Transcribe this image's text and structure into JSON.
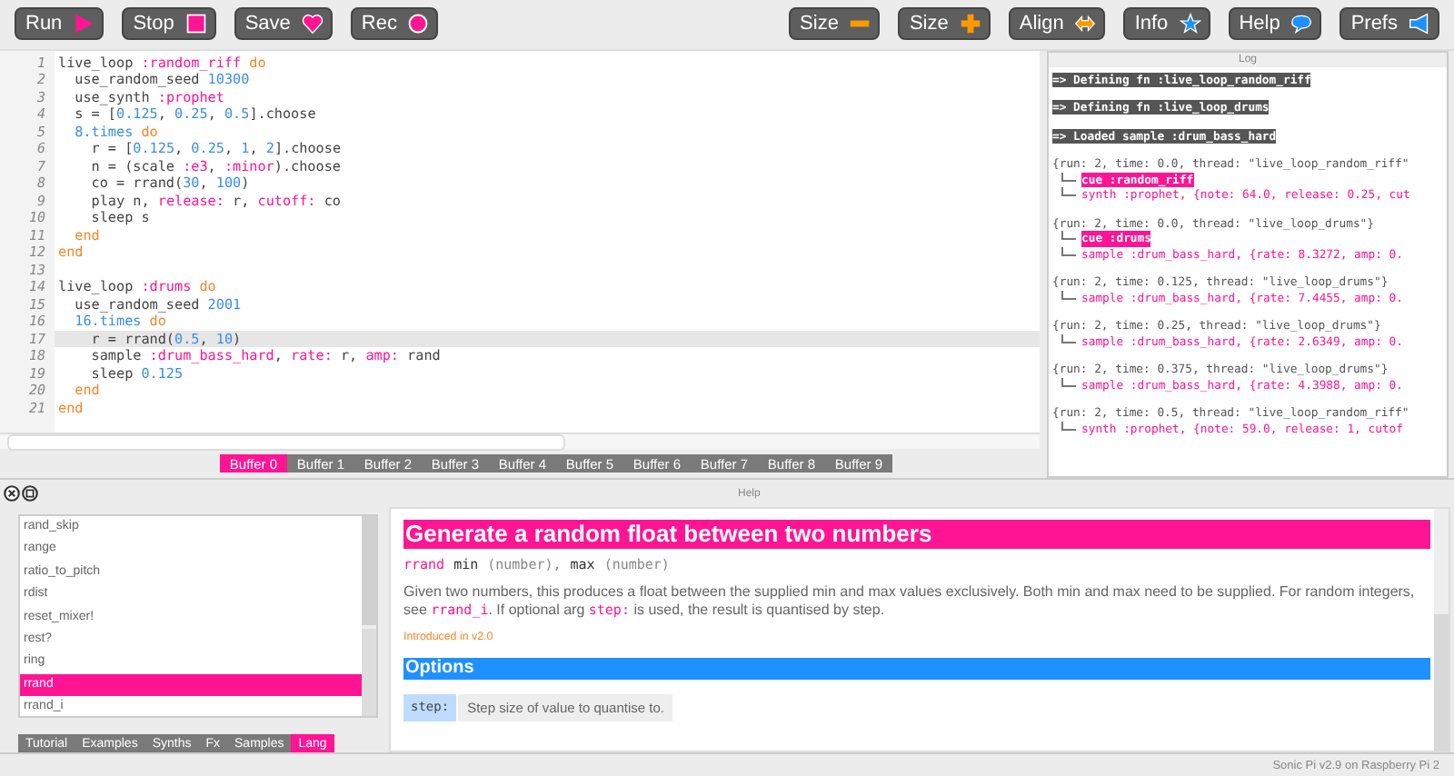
{
  "toolbar": {
    "left": [
      {
        "label": "Run",
        "kind": "play"
      },
      {
        "label": "Stop",
        "kind": "stop"
      },
      {
        "label": "Save",
        "kind": "heart"
      },
      {
        "label": "Rec",
        "kind": "record"
      }
    ],
    "right": [
      {
        "label": "Size",
        "kind": "minus"
      },
      {
        "label": "Size",
        "kind": "plus"
      },
      {
        "label": "Align",
        "kind": "align"
      },
      {
        "label": "Info",
        "kind": "star"
      },
      {
        "label": "Help",
        "kind": "bubble"
      },
      {
        "label": "Prefs",
        "kind": "speaker"
      }
    ]
  },
  "editor": {
    "lines": [
      {
        "number": "1",
        "current": false,
        "tokens": [
          {
            "kind": "plain",
            "text": "live_loop "
          },
          {
            "kind": "sym",
            "text": ":random_riff"
          },
          {
            "kind": "kw",
            "text": " do"
          }
        ]
      },
      {
        "number": "2",
        "current": false,
        "tokens": [
          {
            "kind": "plain",
            "text": "  use_random_seed "
          },
          {
            "kind": "num",
            "text": "10300"
          }
        ]
      },
      {
        "number": "3",
        "current": false,
        "tokens": [
          {
            "kind": "plain",
            "text": "  use_synth "
          },
          {
            "kind": "sym",
            "text": ":prophet"
          }
        ]
      },
      {
        "number": "4",
        "current": false,
        "tokens": [
          {
            "kind": "plain",
            "text": "  s = ["
          },
          {
            "kind": "num",
            "text": "0.125"
          },
          {
            "kind": "plain",
            "text": ", "
          },
          {
            "kind": "num",
            "text": "0.25"
          },
          {
            "kind": "plain",
            "text": ", "
          },
          {
            "kind": "num",
            "text": "0.5"
          },
          {
            "kind": "plain",
            "text": "].choose"
          }
        ]
      },
      {
        "number": "5",
        "current": false,
        "tokens": [
          {
            "kind": "num",
            "text": "  8.times"
          },
          {
            "kind": "kw",
            "text": " do"
          }
        ]
      },
      {
        "number": "6",
        "current": false,
        "tokens": [
          {
            "kind": "plain",
            "text": "    r = ["
          },
          {
            "kind": "num",
            "text": "0.125"
          },
          {
            "kind": "plain",
            "text": ", "
          },
          {
            "kind": "num",
            "text": "0.25"
          },
          {
            "kind": "plain",
            "text": ", "
          },
          {
            "kind": "num",
            "text": "1"
          },
          {
            "kind": "plain",
            "text": ", "
          },
          {
            "kind": "num",
            "text": "2"
          },
          {
            "kind": "plain",
            "text": "].choose"
          }
        ]
      },
      {
        "number": "7",
        "current": false,
        "tokens": [
          {
            "kind": "plain",
            "text": "    n = (scale "
          },
          {
            "kind": "sym",
            "text": ":e3"
          },
          {
            "kind": "plain",
            "text": ", "
          },
          {
            "kind": "sym",
            "text": ":minor"
          },
          {
            "kind": "plain",
            "text": ").choose"
          }
        ]
      },
      {
        "number": "8",
        "current": false,
        "tokens": [
          {
            "kind": "plain",
            "text": "    co = rrand("
          },
          {
            "kind": "num",
            "text": "30"
          },
          {
            "kind": "plain",
            "text": ", "
          },
          {
            "kind": "num",
            "text": "100"
          },
          {
            "kind": "plain",
            "text": ")"
          }
        ]
      },
      {
        "number": "9",
        "current": false,
        "tokens": [
          {
            "kind": "plain",
            "text": "    play n, "
          },
          {
            "kind": "sym",
            "text": "release:"
          },
          {
            "kind": "plain",
            "text": " r, "
          },
          {
            "kind": "sym",
            "text": "cutoff:"
          },
          {
            "kind": "plain",
            "text": " co"
          }
        ]
      },
      {
        "number": "10",
        "current": false,
        "tokens": [
          {
            "kind": "plain",
            "text": "    sleep s"
          }
        ]
      },
      {
        "number": "11",
        "current": false,
        "tokens": [
          {
            "kind": "kw",
            "text": "  end"
          }
        ]
      },
      {
        "number": "12",
        "current": false,
        "tokens": [
          {
            "kind": "kw",
            "text": "end"
          }
        ]
      },
      {
        "number": "13",
        "current": false
      },
      {
        "number": "14",
        "current": false,
        "tokens": [
          {
            "kind": "plain",
            "text": "live_loop "
          },
          {
            "kind": "sym",
            "text": ":drums"
          },
          {
            "kind": "kw",
            "text": " do"
          }
        ]
      },
      {
        "number": "15",
        "current": false,
        "tokens": [
          {
            "kind": "plain",
            "text": "  use_random_seed "
          },
          {
            "kind": "num",
            "text": "2001"
          }
        ]
      },
      {
        "number": "16",
        "current": false,
        "tokens": [
          {
            "kind": "num",
            "text": "  16.times"
          },
          {
            "kind": "kw",
            "text": " do"
          }
        ]
      },
      {
        "number": "17",
        "current": true,
        "tokens": [
          {
            "kind": "plain",
            "text": "    r = rrand("
          },
          {
            "kind": "num",
            "text": "0.5"
          },
          {
            "kind": "plain",
            "text": ", "
          },
          {
            "kind": "num",
            "text": "10"
          },
          {
            "kind": "plain",
            "text": ")"
          }
        ]
      },
      {
        "number": "18",
        "current": false,
        "tokens": [
          {
            "kind": "plain",
            "text": "    sample "
          },
          {
            "kind": "sym",
            "text": ":drum_bass_hard"
          },
          {
            "kind": "plain",
            "text": ", "
          },
          {
            "kind": "sym",
            "text": "rate:"
          },
          {
            "kind": "plain",
            "text": " r, "
          },
          {
            "kind": "sym",
            "text": "amp:"
          },
          {
            "kind": "plain",
            "text": " rand"
          }
        ]
      },
      {
        "number": "19",
        "current": false,
        "tokens": [
          {
            "kind": "plain",
            "text": "    sleep "
          },
          {
            "kind": "num",
            "text": "0.125"
          }
        ]
      },
      {
        "number": "20",
        "current": false,
        "tokens": [
          {
            "kind": "kw",
            "text": "  end"
          }
        ]
      },
      {
        "number": "21",
        "current": false,
        "tokens": [
          {
            "kind": "kw",
            "text": "end"
          }
        ]
      }
    ],
    "buffers": [
      {
        "label": "Buffer 0",
        "selected": true
      },
      {
        "label": "Buffer 1",
        "selected": false
      },
      {
        "label": "Buffer 2",
        "selected": false
      },
      {
        "label": "Buffer 3",
        "selected": false
      },
      {
        "label": "Buffer 4",
        "selected": false
      },
      {
        "label": "Buffer 5",
        "selected": false
      },
      {
        "label": "Buffer 6",
        "selected": false
      },
      {
        "label": "Buffer 7",
        "selected": false
      },
      {
        "label": "Buffer 8",
        "selected": false
      },
      {
        "label": "Buffer 9",
        "selected": false
      }
    ]
  },
  "log": {
    "title": "Log",
    "entries": [
      {
        "kind": "marker",
        "text": "=> Defining fn :live_loop_random_riff"
      },
      {
        "kind": "marker",
        "text": "=> Defining fn :live_loop_drums"
      },
      {
        "kind": "marker",
        "text": "=> Loaded sample :drum_bass_hard"
      },
      {
        "kind": "run",
        "header": "{run: 2, time: 0.0, thread: \"live_loop_random_riff\"",
        "lines": [
          {
            "kind": "cue",
            "text": "cue :random_riff"
          },
          {
            "kind": "action",
            "text": "synth :prophet, {note: 64.0, release: 0.25, cut"
          }
        ]
      },
      {
        "kind": "run",
        "header": "{run: 2, time: 0.0, thread: \"live_loop_drums\"}",
        "lines": [
          {
            "kind": "cue",
            "text": "cue :drums"
          },
          {
            "kind": "action",
            "text": "sample :drum_bass_hard, {rate: 8.3272, amp: 0."
          }
        ]
      },
      {
        "kind": "run",
        "header": "{run: 2, time: 0.125, thread: \"live_loop_drums\"}",
        "lines": [
          {
            "kind": "action",
            "text": "sample :drum_bass_hard, {rate: 7.4455, amp: 0."
          }
        ]
      },
      {
        "kind": "run",
        "header": "{run: 2, time: 0.25, thread: \"live_loop_drums\"}",
        "lines": [
          {
            "kind": "action",
            "text": "sample :drum_bass_hard, {rate: 2.6349, amp: 0."
          }
        ]
      },
      {
        "kind": "run",
        "header": "{run: 2, time: 0.375, thread: \"live_loop_drums\"}",
        "lines": [
          {
            "kind": "action",
            "text": "sample :drum_bass_hard, {rate: 4.3988, amp: 0."
          }
        ]
      },
      {
        "kind": "run",
        "header": "{run: 2, time: 0.5, thread: \"live_loop_random_riff\"",
        "lines": [
          {
            "kind": "action",
            "text": "synth :prophet, {note: 59.0, release: 1, cutof"
          }
        ]
      }
    ]
  },
  "help": {
    "title": "Help",
    "items": [
      {
        "label": "rand_skip",
        "selected": false
      },
      {
        "label": "range",
        "selected": false
      },
      {
        "label": "ratio_to_pitch",
        "selected": false
      },
      {
        "label": "rdist",
        "selected": false
      },
      {
        "label": "reset_mixer!",
        "selected": false
      },
      {
        "label": "rest?",
        "selected": false
      },
      {
        "label": "ring",
        "selected": false
      },
      {
        "label": "rrand",
        "selected": true
      },
      {
        "label": "rrand_i",
        "selected": false
      }
    ],
    "tabs": [
      {
        "label": "Tutorial",
        "selected": false
      },
      {
        "label": "Examples",
        "selected": false
      },
      {
        "label": "Synths",
        "selected": false
      },
      {
        "label": "Fx",
        "selected": false
      },
      {
        "label": "Samples",
        "selected": false
      },
      {
        "label": "Lang",
        "selected": true
      }
    ],
    "heading": "Generate a random float between two numbers",
    "signature": [
      {
        "kind": "name",
        "text": "rrand"
      },
      {
        "kind": "arg",
        "text": "min"
      },
      {
        "kind": "type",
        "text": "(number),"
      },
      {
        "kind": "arg",
        "text": "max"
      },
      {
        "kind": "type",
        "text": "(number)"
      }
    ],
    "description": [
      {
        "kind": "text",
        "text": "Given two numbers, this produces a float between the supplied min and max values exclusively. Both min and max need to be supplied. For random integers, see "
      },
      {
        "kind": "code",
        "text": "rrand_i"
      },
      {
        "kind": "text",
        "text": ". If optional arg "
      },
      {
        "kind": "code",
        "text": "step:"
      },
      {
        "kind": "text",
        "text": " is used, the result is quantised by step."
      }
    ],
    "introduced": "Introduced in v2.0",
    "options_heading": "Options",
    "options": [
      {
        "name": "step:",
        "description": "Step size of value to quantise to."
      }
    ]
  },
  "status_bar": "Sonic Pi v2.9 on Raspberry Pi 2"
}
